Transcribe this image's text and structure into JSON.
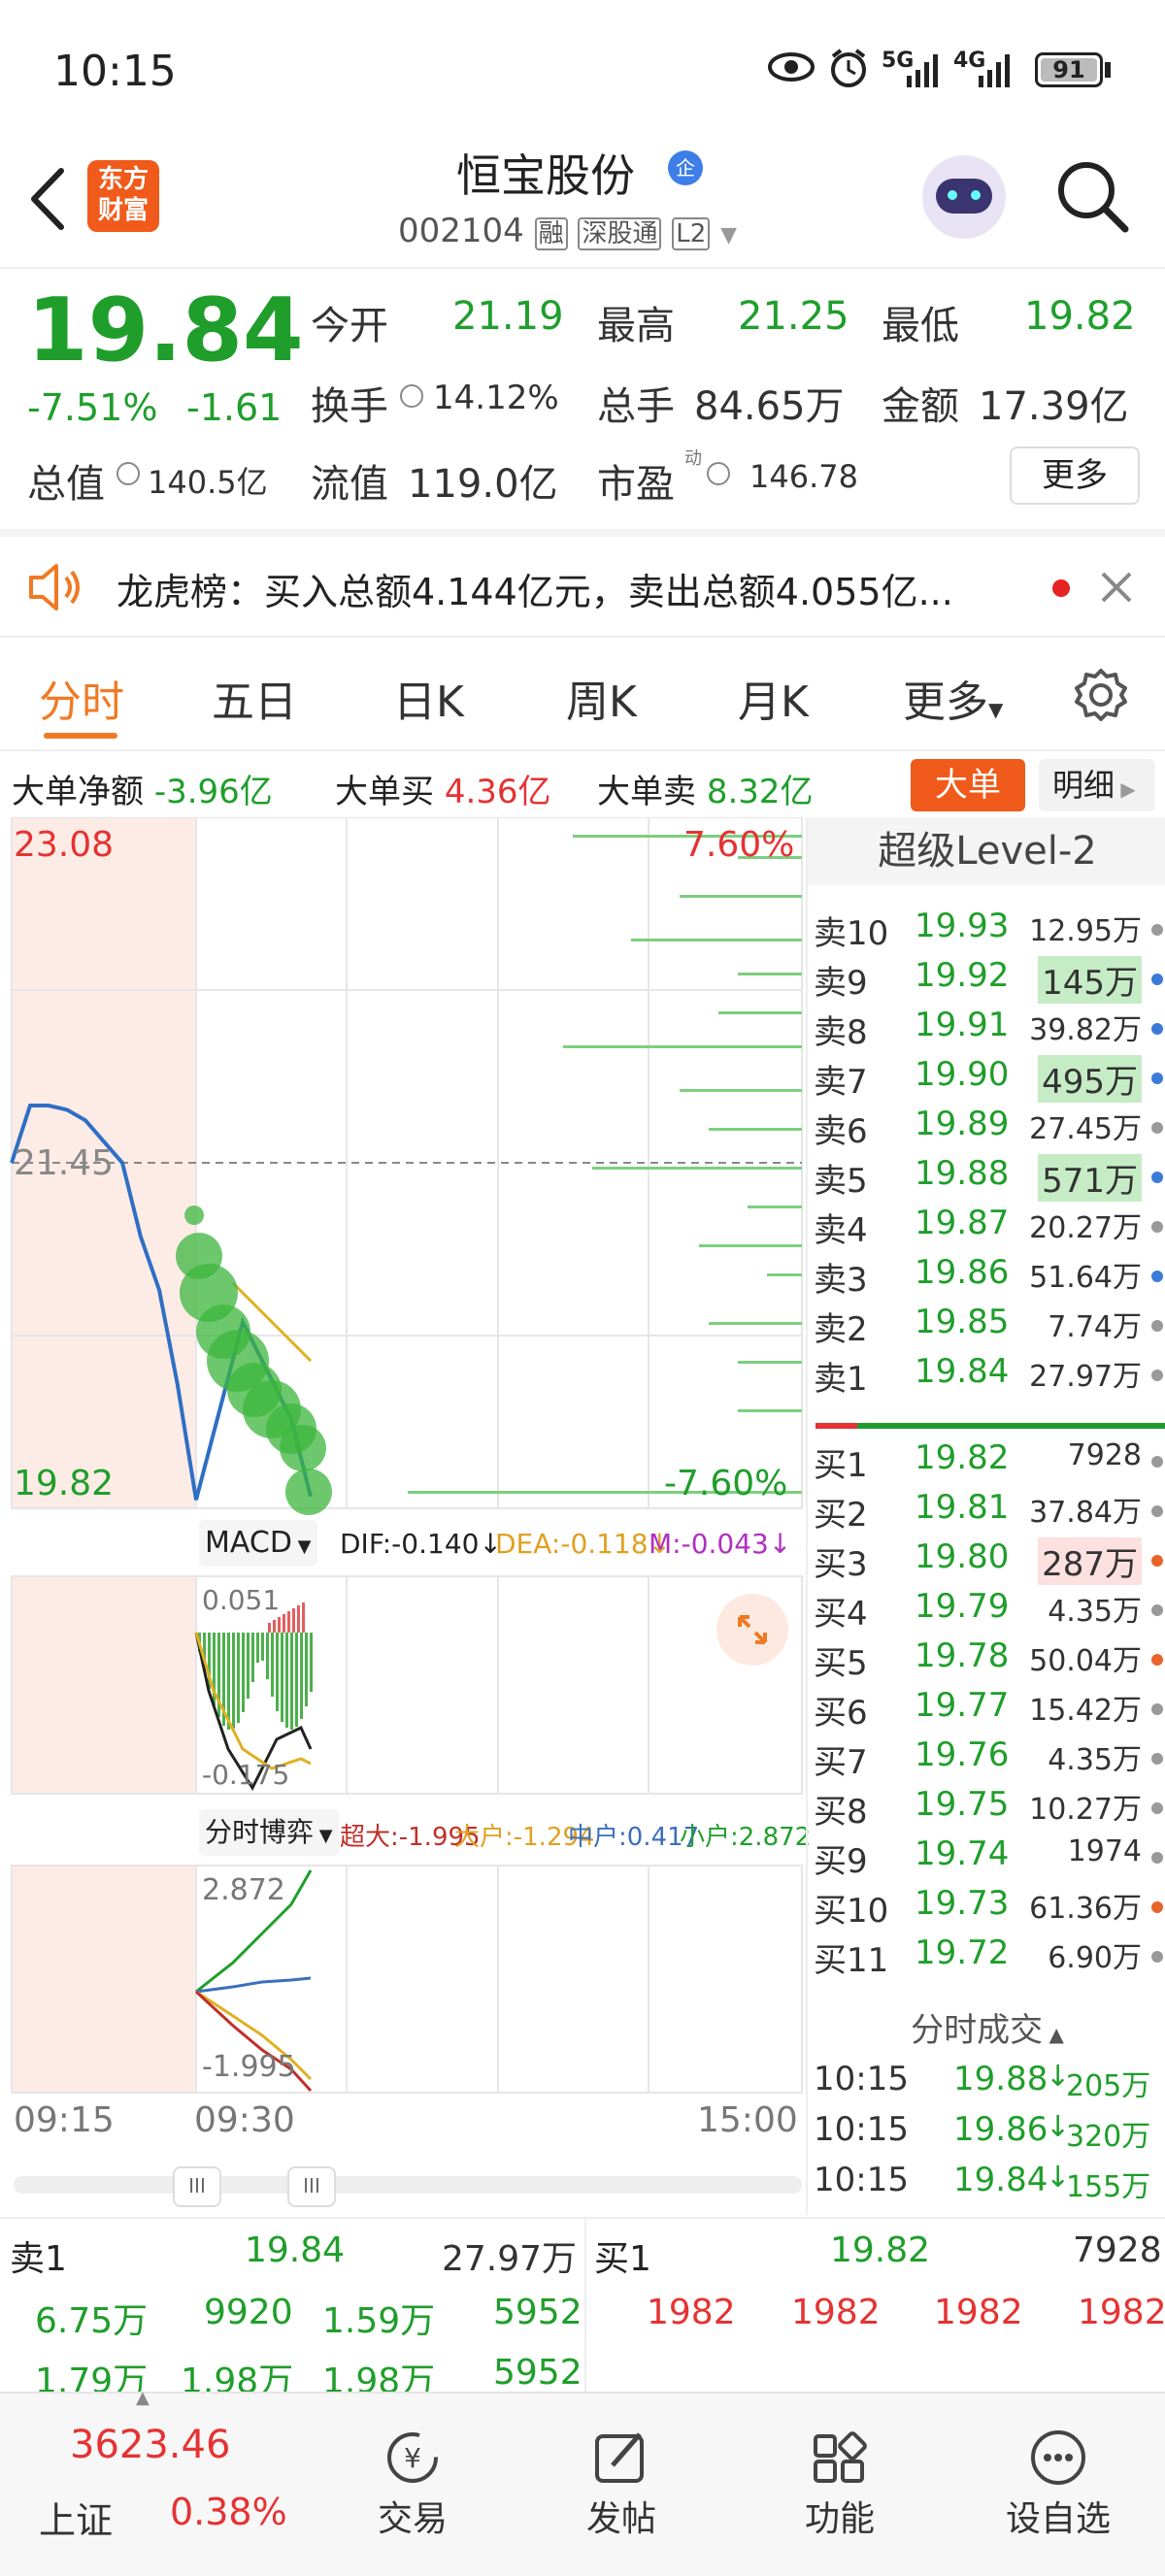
{
  "status": {
    "time": "10:15",
    "signal1": "5G",
    "signal2": "4G",
    "battery": "91"
  },
  "header": {
    "title": "恒宝股份",
    "code": "002104",
    "tags": [
      "融",
      "深股通",
      "L2"
    ],
    "logo_line1": "东方",
    "logo_line2": "财富"
  },
  "quote": {
    "price": "19.84",
    "change_pct": "-7.51%",
    "change": "-1.61",
    "open_label": "今开",
    "open": "21.19",
    "high_label": "最高",
    "high": "21.25",
    "low_label": "最低",
    "low": "19.82",
    "turnover_label": "换手",
    "turnover": "14.12%",
    "volume_label": "总手",
    "volume": "84.65万",
    "amount_label": "金额",
    "amount": "17.39亿",
    "mktcap_label": "总值",
    "mktcap": "140.5亿",
    "float_label": "流值",
    "float": "119.0亿",
    "pe_label": "市盈",
    "pe_sup": "动",
    "pe": "146.78",
    "more": "更多"
  },
  "notice": {
    "text": "龙虎榜：买入总额4.144亿元，卖出总额4.055亿..."
  },
  "tabs": [
    "分时",
    "五日",
    "日K",
    "周K",
    "月K",
    "更多"
  ],
  "bigorder": {
    "net_label": "大单净额",
    "net": "-3.96亿",
    "buy_label": "大单买",
    "buy": "4.36亿",
    "sell_label": "大单卖",
    "sell": "8.32亿",
    "btn_big": "大单",
    "btn_detail": "明细"
  },
  "chart": {
    "price_high": "23.08",
    "price_mid": "21.45",
    "price_low": "19.82",
    "pct_high": "7.60%",
    "pct_low": "-7.60%",
    "time_start": "09:15",
    "time_mid": "09:30",
    "time_end": "15:00"
  },
  "chart_data": {
    "type": "line",
    "x": [
      "09:15",
      "09:18",
      "09:21",
      "09:24",
      "09:25",
      "09:28",
      "09:30",
      "09:32",
      "09:34",
      "09:36",
      "09:38"
    ],
    "series": [
      {
        "values": [
          21.45,
          21.72,
          21.72,
          21.7,
          21.65,
          21.55,
          21.45,
          21.1,
          20.85,
          20.4,
          19.86
        ]
      }
    ],
    "ylim": [
      19.82,
      23.08
    ]
  },
  "macd": {
    "label": "MACD",
    "dif": "DIF:-0.140",
    "dea": "DEA:-0.118",
    "m": "M:-0.043",
    "top": "0.051",
    "bottom": "-0.175"
  },
  "flow": {
    "label": "分时博弈",
    "super": "超大:-1.995",
    "big": "大户:-1.294",
    "mid": "中户:0.417",
    "small": "小户:2.872",
    "top": "2.872",
    "bottom": "-1.995"
  },
  "level2": {
    "title": "超级Level-2",
    "asks": [
      {
        "label": "卖10",
        "price": "19.93",
        "vol": "12.95万",
        "dot": "#999"
      },
      {
        "label": "卖9",
        "price": "19.92",
        "vol": "145万",
        "dot": "#3b7bd8"
      },
      {
        "label": "卖8",
        "price": "19.91",
        "vol": "39.82万",
        "dot": "#3b7bd8"
      },
      {
        "label": "卖7",
        "price": "19.90",
        "vol": "495万",
        "dot": "#3b7bd8"
      },
      {
        "label": "卖6",
        "price": "19.89",
        "vol": "27.45万",
        "dot": "#999"
      },
      {
        "label": "卖5",
        "price": "19.88",
        "vol": "571万",
        "dot": "#3b7bd8"
      },
      {
        "label": "卖4",
        "price": "19.87",
        "vol": "20.27万",
        "dot": "#999"
      },
      {
        "label": "卖3",
        "price": "19.86",
        "vol": "51.64万",
        "dot": "#3b7bd8"
      },
      {
        "label": "卖2",
        "price": "19.85",
        "vol": "7.74万",
        "dot": "#999"
      },
      {
        "label": "卖1",
        "price": "19.84",
        "vol": "27.97万",
        "dot": "#999"
      }
    ],
    "bids": [
      {
        "label": "买1",
        "price": "19.82",
        "vol": "7928",
        "dot": "#999"
      },
      {
        "label": "买2",
        "price": "19.81",
        "vol": "37.84万",
        "dot": "#999"
      },
      {
        "label": "买3",
        "price": "19.80",
        "vol": "287万",
        "dot": "#e8642a"
      },
      {
        "label": "买4",
        "price": "19.79",
        "vol": "4.35万",
        "dot": "#999"
      },
      {
        "label": "买5",
        "price": "19.78",
        "vol": "50.04万",
        "dot": "#e8642a"
      },
      {
        "label": "买6",
        "price": "19.77",
        "vol": "15.42万",
        "dot": "#999"
      },
      {
        "label": "买7",
        "price": "19.76",
        "vol": "4.35万",
        "dot": "#999"
      },
      {
        "label": "买8",
        "price": "19.75",
        "vol": "10.27万",
        "dot": "#999"
      },
      {
        "label": "买9",
        "price": "19.74",
        "vol": "1974",
        "dot": "#999"
      },
      {
        "label": "买10",
        "price": "19.73",
        "vol": "61.36万",
        "dot": "#e8642a"
      },
      {
        "label": "买11",
        "price": "19.72",
        "vol": "6.90万",
        "dot": "#999"
      }
    ],
    "trades_title": "分时成交",
    "trades": [
      {
        "time": "10:15",
        "price": "19.88",
        "vol": "205万"
      },
      {
        "time": "10:15",
        "price": "19.86",
        "vol": "320万"
      },
      {
        "time": "10:15",
        "price": "19.84",
        "vol": "155万"
      }
    ]
  },
  "bottom_book": {
    "sell1_label": "卖1",
    "sell1_price": "19.84",
    "sell1_vol": "27.97万",
    "buy1_label": "买1",
    "buy1_price": "19.82",
    "buy1_vol": "7928",
    "sell_queue": [
      "6.75万",
      "9920",
      "1.59万",
      "5952",
      "1.79万",
      "1.98万",
      "1.98万",
      "5952"
    ],
    "buy_queue": [
      "1982",
      "1982",
      "1982",
      "1982"
    ]
  },
  "tabbar": {
    "index_value": "3623.46",
    "index_name": "上证",
    "index_pct": "0.38%",
    "trade": "交易",
    "post": "发帖",
    "func": "功能",
    "watch": "设自选"
  }
}
